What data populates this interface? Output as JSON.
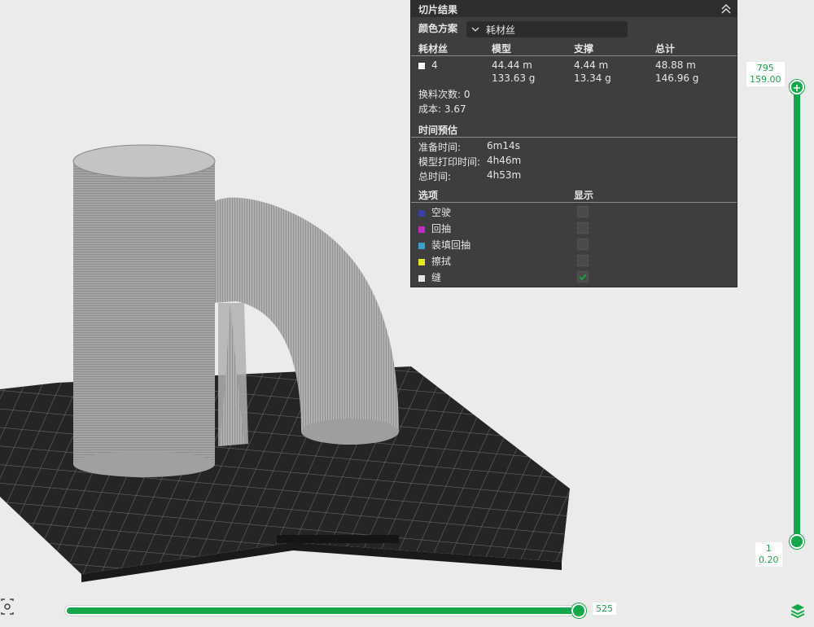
{
  "panel": {
    "title": "切片结果",
    "color_scheme_label": "颜色方案",
    "color_scheme_value": "耗材丝",
    "headers": {
      "filament": "耗材丝",
      "model": "模型",
      "support": "支撑",
      "total": "总计"
    },
    "filament_row": {
      "id": "4",
      "model_length": "44.44 m",
      "model_weight": "133.63 g",
      "support_length": "4.44 m",
      "support_weight": "13.34 g",
      "total_length": "48.88 m",
      "total_weight": "146.96 g"
    },
    "changes_label": "换料次数:",
    "changes_value": "0",
    "cost_label": "成本:",
    "cost_value": "3.67",
    "time_title": "时间预估",
    "prep_label": "准备时间:",
    "prep_value": "6m14s",
    "model_time_label": "模型打印时间:",
    "model_time_value": "4h46m",
    "total_time_label": "总时间:",
    "total_time_value": "4h53m",
    "options_title": "选项",
    "display_title": "显示",
    "options": [
      {
        "label": "空驶",
        "color": "#3a3fa8",
        "checked": false
      },
      {
        "label": "回抽",
        "color": "#c02bc0",
        "checked": false
      },
      {
        "label": "装填回抽",
        "color": "#3aa0c8",
        "checked": false
      },
      {
        "label": "擦拭",
        "color": "#e8e822",
        "checked": false
      },
      {
        "label": "缝",
        "color": "#e6e6e6",
        "checked": true
      }
    ]
  },
  "layer_slider": {
    "top_layer": "795",
    "top_height": "159.00",
    "bottom_layer": "1",
    "bottom_height": "0.20"
  },
  "move_slider": {
    "value": "525"
  },
  "icons": {
    "collapse": "double-chevron-up-icon",
    "layers": "layers-icon",
    "fit": "fit-view-icon"
  },
  "colors": {
    "accent": "#14a84a",
    "panel_bg": "#3e3e3e",
    "plate": "#2b2b2b",
    "model": "#9a9a9a"
  }
}
